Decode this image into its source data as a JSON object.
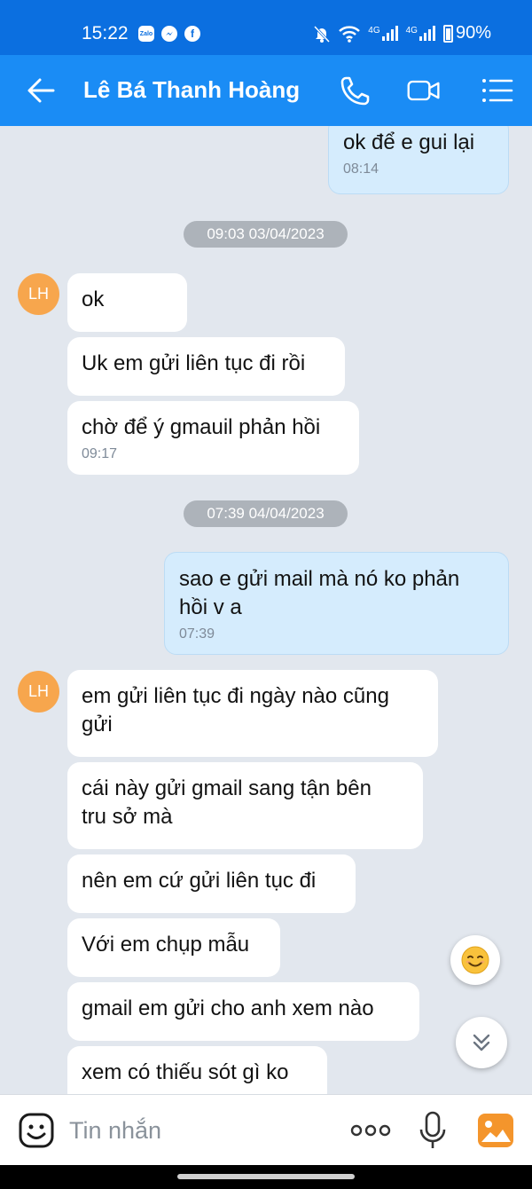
{
  "status_bar": {
    "time": "15:22",
    "battery": "90%",
    "network_1": "4G",
    "network_2": "4G",
    "app_zalo": "Zalo"
  },
  "header": {
    "title": "Lê Bá Thanh Hoàng"
  },
  "messages": {
    "m1": {
      "text": "ok để e gui lại",
      "time": "08:14"
    },
    "date1": "09:03 03/04/2023",
    "avatar_initials": "LH",
    "m2": {
      "text": "ok"
    },
    "m3": {
      "text": "Uk em gửi liên tục đi rồi"
    },
    "m4": {
      "text": "chờ để ý gmauil phản hồi",
      "time": "09:17"
    },
    "date2": "07:39 04/04/2023",
    "m5": {
      "line1": "sao e gửi mail mà nó ko phản",
      "line2": "hồi v a",
      "time": "07:39"
    },
    "m6": {
      "line1": "em gửi liên tục đi ngày nào cũng",
      "line2": "gửi"
    },
    "m7": {
      "line1": "cái này gửi gmail sang tận bên",
      "line2": "tru sở mà"
    },
    "m8": {
      "text": "nên em cứ gửi liên tục đi"
    },
    "m9": {
      "text": "Với em chụp mẫu"
    },
    "m10": {
      "text": "gmail em gửi cho anh xem nào"
    },
    "m11": {
      "text": "xem có thiếu sót gì ko"
    }
  },
  "input": {
    "placeholder": "Tin nhắn"
  },
  "colors": {
    "header": "#1a8cf5",
    "status_bar": "#0b6fe0",
    "outgoing_bubble": "#d5ecfd",
    "incoming_bubble": "#ffffff",
    "background": "#e2e7ee",
    "avatar": "#f7a64d"
  }
}
